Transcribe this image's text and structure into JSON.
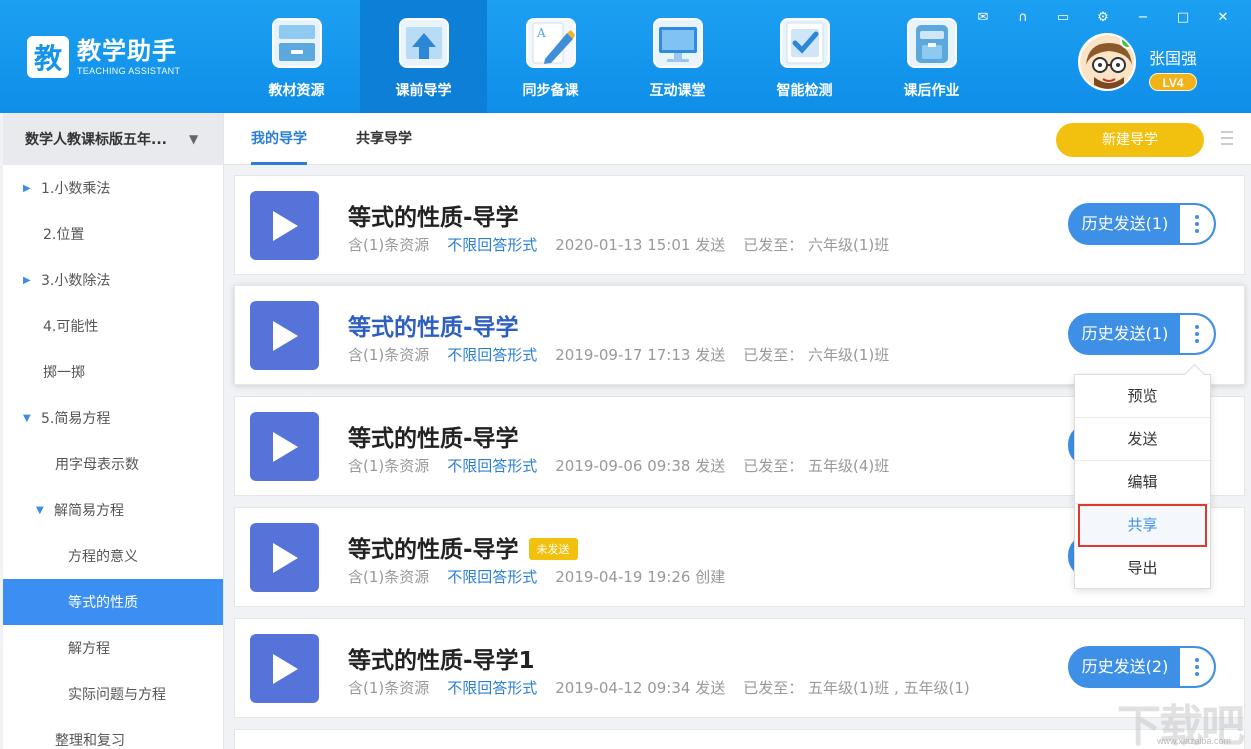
{
  "app": {
    "logo_char": "教",
    "title": "教学助手",
    "subtitle": "TEACHING ASSISTANT"
  },
  "nav": [
    {
      "label": "教材资源",
      "icon": "cabinet-icon"
    },
    {
      "label": "课前导学",
      "icon": "upload-document-icon"
    },
    {
      "label": "同步备课",
      "icon": "pen-document-icon"
    },
    {
      "label": "互动课堂",
      "icon": "monitor-icon"
    },
    {
      "label": "智能检测",
      "icon": "checklist-icon"
    },
    {
      "label": "课后作业",
      "icon": "backpack-icon"
    }
  ],
  "user": {
    "name": "张国强",
    "level": "LV4"
  },
  "sidebar": {
    "header": "数学人教课标版五年...",
    "items": [
      {
        "label": "1.小数乘法"
      },
      {
        "label": "2.位置"
      },
      {
        "label": "3.小数除法"
      },
      {
        "label": "4.可能性"
      },
      {
        "label": "掷一掷"
      },
      {
        "label": "5.简易方程"
      },
      {
        "label": "用字母表示数"
      },
      {
        "label": "解简易方程"
      },
      {
        "label": "方程的意义"
      },
      {
        "label": "等式的性质"
      },
      {
        "label": "解方程"
      },
      {
        "label": "实际问题与方程"
      },
      {
        "label": "整理和复习"
      }
    ]
  },
  "tabs": {
    "mine": "我的导学",
    "shared": "共享导学",
    "new_button": "新建导学"
  },
  "cards": [
    {
      "title": "等式的性质-导学",
      "resources": "含(1)条资源",
      "mode": "不限回答形式",
      "date": "2020-01-13 15:01 发送",
      "sent_to": "已发至： 六年级(1)班",
      "history": "历史发送(1)"
    },
    {
      "title": "等式的性质-导学",
      "resources": "含(1)条资源",
      "mode": "不限回答形式",
      "date": "2019-09-17 17:13 发送",
      "sent_to": "已发至： 六年级(1)班",
      "history": "历史发送(1)"
    },
    {
      "title": "等式的性质-导学",
      "resources": "含(1)条资源",
      "mode": "不限回答形式",
      "date": "2019-09-06 09:38 发送",
      "sent_to": "已发至： 五年级(4)班",
      "history": ""
    },
    {
      "title": "等式的性质-导学",
      "badge": "未发送",
      "resources": "含(1)条资源",
      "mode": "不限回答形式",
      "date": "2019-04-19 19:26 创建",
      "sent_to": "",
      "history": ""
    },
    {
      "title": "等式的性质-导学1",
      "resources": "含(1)条资源",
      "mode": "不限回答形式",
      "date": "2019-04-12 09:34 发送",
      "sent_to": "已发至： 五年级(1)班 , 五年级(1)",
      "history": "历史发送(2)"
    }
  ],
  "dropdown": {
    "items": [
      "预览",
      "发送",
      "编辑",
      "共享",
      "导出"
    ]
  },
  "watermark": {
    "text": "下载吧",
    "url": "www.xiazaiba.com"
  },
  "colors": {
    "header_blue": "#1592ea",
    "accent_blue": "#3e8fe6",
    "play_purple": "#5573d8",
    "yellow": "#f2c00e",
    "highlight_red": "#e0382e"
  }
}
